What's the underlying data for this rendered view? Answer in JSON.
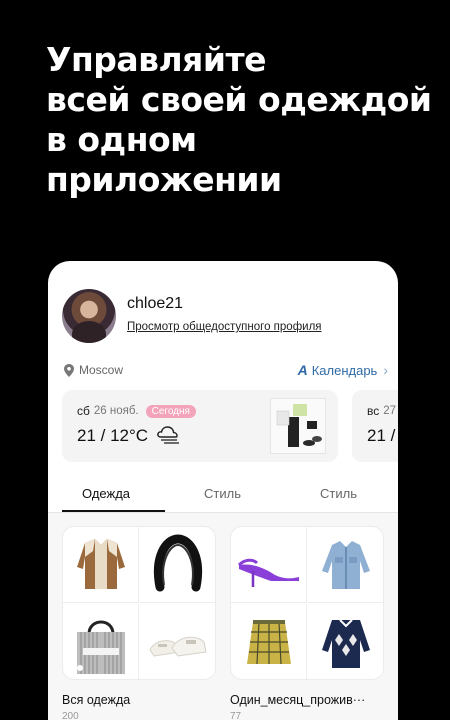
{
  "headline": {
    "line1": "Управляйте",
    "line2": "всей своей одеждой",
    "line3": "в одном",
    "line4": "приложении"
  },
  "profile": {
    "username": "chloe21",
    "public_profile_link": "Просмотр общедоступного профиля"
  },
  "location": {
    "city": "Moscow",
    "icon": "pin-icon"
  },
  "calendar": {
    "label": "Календарь",
    "icon": "calendar-icon",
    "chevron": "›"
  },
  "days": [
    {
      "dow": "сб",
      "date": "26 нояб.",
      "badge": "Сегодня",
      "temperature": "21 / 12°C",
      "weather_icon": "cloud-icon"
    },
    {
      "dow": "вс",
      "date": "27",
      "temperature": "21 /"
    }
  ],
  "tabs": [
    {
      "label": "Одежда",
      "active": true
    },
    {
      "label": "Стиль",
      "active": false
    },
    {
      "label": "Стиль",
      "active": false
    }
  ],
  "collections": [
    {
      "title": "Вся одежда",
      "count": "200"
    },
    {
      "title": "Один_месяц_прожив···",
      "count": "77"
    }
  ],
  "colors": {
    "accent_blue": "#2f6aa6",
    "today_badge": "#f3a3ba",
    "background": "#000000"
  }
}
